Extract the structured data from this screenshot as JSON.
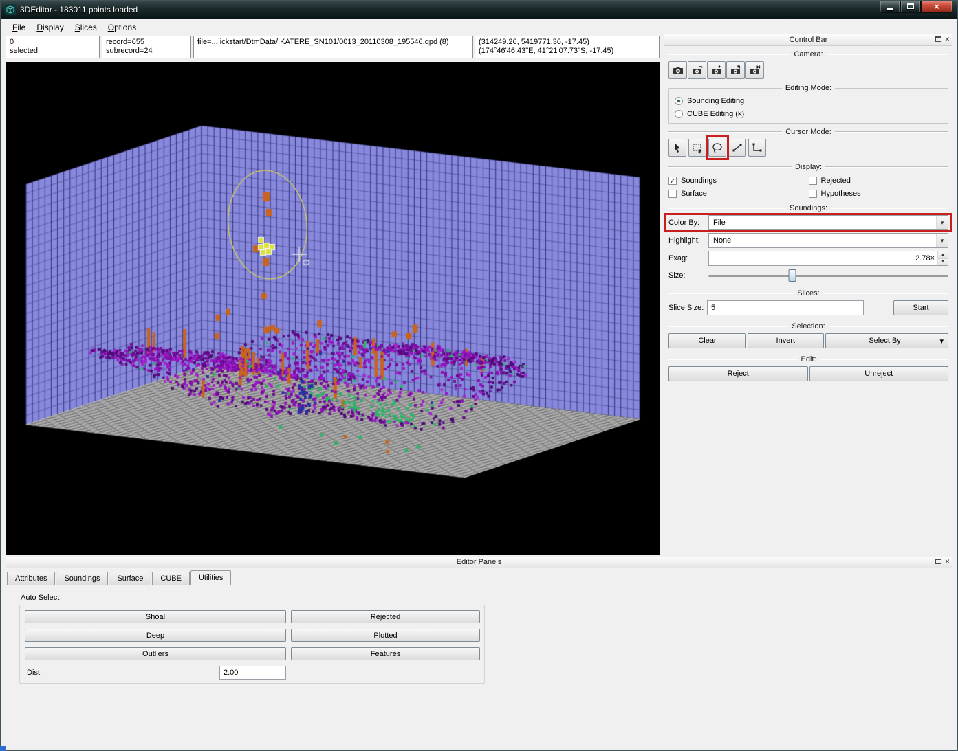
{
  "window": {
    "title": "3DEditor - 183011 points loaded"
  },
  "glyphs": {
    "dropdown": "▾",
    "check": "✓",
    "spin_up": "▲",
    "spin_down": "▼",
    "window_close": "×",
    "panel_close": "×"
  },
  "menu": {
    "items": [
      {
        "label": "File"
      },
      {
        "label": "Display"
      },
      {
        "label": "Slices"
      },
      {
        "label": "Options"
      }
    ]
  },
  "status": {
    "selected_count": "0",
    "selected_label": "selected",
    "record": "record=655",
    "subrecord": "subrecord=24",
    "file": "file=... ickstart/DtmData/IKATERE_SN101/0013_20110308_195546.qpd (8)",
    "coords_utm": "(314249.26, 5419771.36, -17.45)",
    "coords_geo": "(174°46'46.43\"E, 41°21'07.73\"S, -17.45)"
  },
  "control_bar": {
    "title": "Control Bar",
    "camera": {
      "label": "Camera:"
    },
    "editing_mode": {
      "label": "Editing Mode:",
      "options": [
        {
          "label": "Sounding Editing",
          "selected": true
        },
        {
          "label": "CUBE Editing (k)",
          "selected": false
        }
      ]
    },
    "cursor_mode": {
      "label": "Cursor Mode:"
    },
    "display": {
      "label": "Display:",
      "checkboxes": [
        {
          "label": "Soundings",
          "checked": true
        },
        {
          "label": "Rejected",
          "checked": false
        },
        {
          "label": "Surface",
          "checked": false
        },
        {
          "label": "Hypotheses",
          "checked": false
        }
      ]
    },
    "soundings": {
      "label": "Soundings:",
      "color_by_label": "Color By:",
      "color_by_value": "File",
      "highlight_label": "Highlight:",
      "highlight_value": "None",
      "exag_label": "Exag:",
      "exag_value": "2.78×",
      "size_label": "Size:",
      "size_percent": 35
    },
    "slices": {
      "label": "Slices:",
      "slice_size_label": "Slice Size:",
      "slice_size_value": "5",
      "start_button": "Start"
    },
    "selection": {
      "label": "Selection:",
      "clear_button": "Clear",
      "invert_button": "Invert",
      "select_by_button": "Select By"
    },
    "edit": {
      "label": "Edit:",
      "reject_button": "Reject",
      "unreject_button": "Unreject"
    }
  },
  "editor_panels": {
    "title": "Editor Panels",
    "tabs": [
      {
        "label": "Attributes",
        "active": false
      },
      {
        "label": "Soundings",
        "active": false
      },
      {
        "label": "Surface",
        "active": false
      },
      {
        "label": "CUBE",
        "active": false
      },
      {
        "label": "Utilities",
        "active": true
      }
    ],
    "auto_select": {
      "label": "Auto Select",
      "buttons_left": [
        "Shoal",
        "Deep",
        "Outliers"
      ],
      "buttons_right": [
        "Rejected",
        "Plotted",
        "Features"
      ],
      "dist_label": "Dist:",
      "dist_value": "2.00"
    }
  },
  "annotations": {
    "color": "#c81e1e"
  },
  "scene": {
    "background": "#000000",
    "wall_fill": "#8888dc",
    "wall_grid": "#32327a",
    "floor_fill": "#a2a2a2",
    "floor_grid_dark": "#6f6f6f",
    "floor_grid_light": "#c6c6c6",
    "points": {
      "purple": "#8a10b4",
      "green": "#2db467",
      "orange": "#c8641e",
      "blue": "#2832a0",
      "dark": "#500a78",
      "highlight": "#dce23c"
    },
    "lasso_color": "#cfcf5a",
    "cursor_color": "#e6e6e6"
  }
}
